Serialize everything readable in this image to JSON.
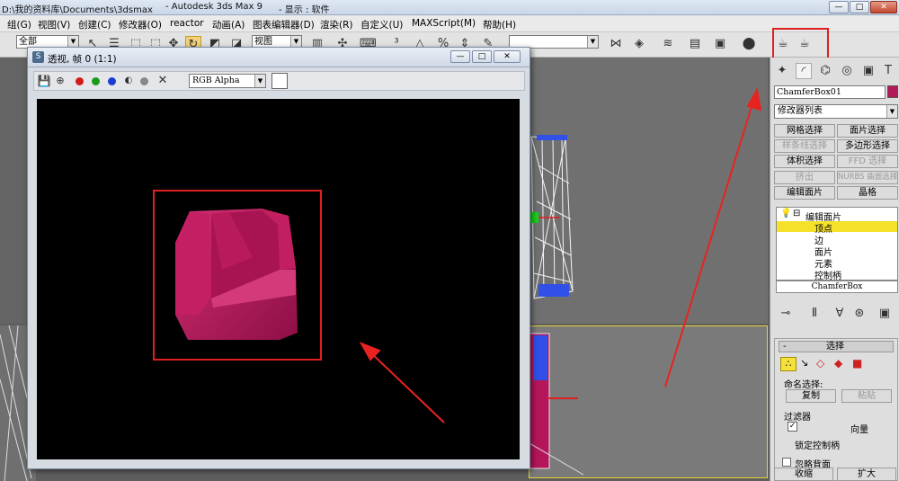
{
  "titlebar": {
    "path": "D:\\我的资料库\\Documents\\3dsmax",
    "app": "- Autodesk 3ds Max 9",
    "display": "- 显示 : 软件"
  },
  "menu": [
    "组(G)",
    "视图(V)",
    "创建(C)",
    "修改器(O)",
    "reactor",
    "动画(A)",
    "图表编辑器(D)",
    "渲染(R)",
    "自定义(U)",
    "MAXScript(M)",
    "帮助(H)"
  ],
  "toolbar": {
    "selection_filter": "全部",
    "reference_coord": "视图"
  },
  "render_window": {
    "title": "透视, 帧 0 (1:1)",
    "channel": "RGB Alpha",
    "colors": {
      "red": "#d21a1a",
      "green": "#1a9a1a",
      "blue": "#1a3ad2"
    }
  },
  "command_panel": {
    "object_name": "ChamferBox01",
    "object_color": "#b4195a",
    "modifier_list": "修改器列表",
    "buttons": [
      [
        "网格选择",
        "面片选择"
      ],
      [
        "样条线选择",
        "多边形选择"
      ],
      [
        "体积选择",
        "FFD 选择"
      ],
      [
        "挤出",
        "NURBS 曲面选择"
      ],
      [
        "编辑面片",
        "晶格"
      ]
    ],
    "stack": {
      "modifier": "编辑面片",
      "sub": [
        "顶点",
        "边",
        "面片",
        "元素",
        "控制柄"
      ],
      "base": "ChamferBox"
    },
    "selection": {
      "rollout": "选择",
      "named_sel": "命名选择:",
      "copy": "复制",
      "paste": "粘贴",
      "filter": "过滤器",
      "face_normal": "向量",
      "lock_handles": "锁定控制柄",
      "ignore_back": "忽略背面",
      "shrink": "收缩",
      "grow": "扩大"
    }
  },
  "accent": {
    "highlight": "#e0201f",
    "chair": "#b5165a"
  }
}
